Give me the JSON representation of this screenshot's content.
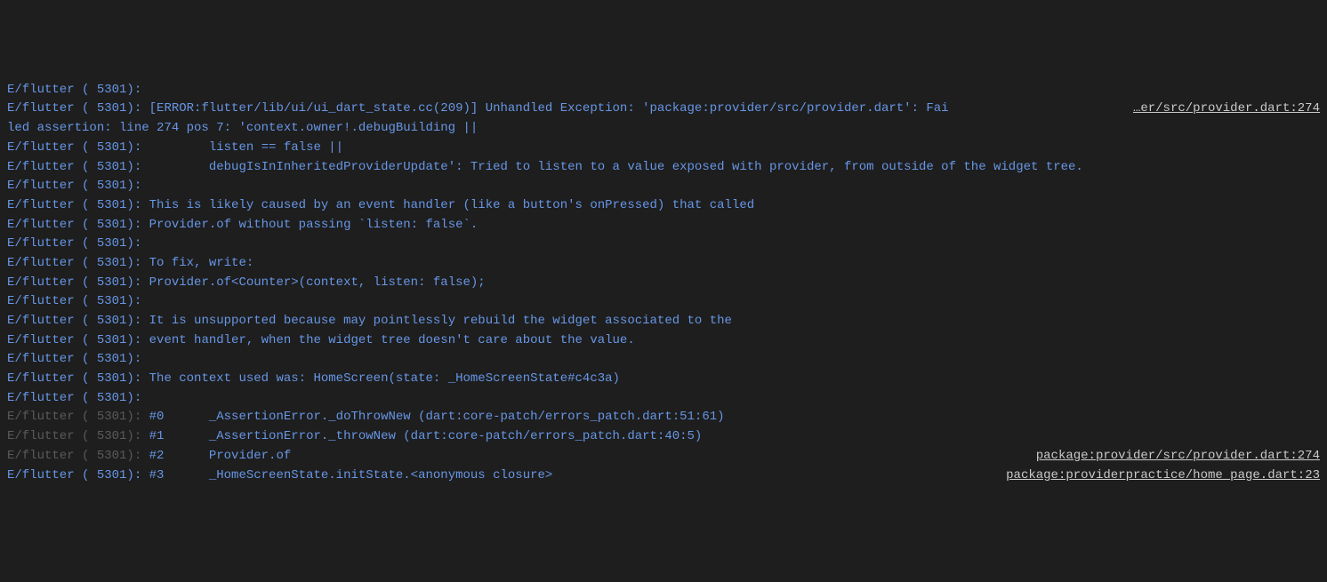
{
  "prefix": "E/flutter ( 5301):",
  "links": {
    "provider274_trunc": "…er/src/provider.dart:274",
    "provider274": "package:provider/src/provider.dart:274",
    "homepage23": "package:providerpractice/home_page.dart:23"
  },
  "lines": [
    {
      "text": " ",
      "dim": false
    },
    {
      "text": " [ERROR:flutter/lib/ui/ui_dart_state.cc(209)] Unhandled Exception: 'package:provider/src/provider.dart': Fai",
      "dim": false,
      "link": "provider274_trunc",
      "noPrefixContinuation": false
    },
    {
      "text": "led assertion: line 274 pos 7: 'context.owner!.debugBuilding ||",
      "dim": false,
      "raw": true
    },
    {
      "text": "         listen == false ||",
      "dim": false
    },
    {
      "text": "         debugIsInInheritedProviderUpdate': Tried to listen to a value exposed with provider, from outside of the widget tree.",
      "dim": false
    },
    {
      "text": " ",
      "dim": false
    },
    {
      "text": " This is likely caused by an event handler (like a button's onPressed) that called",
      "dim": false
    },
    {
      "text": " Provider.of without passing `listen: false`.",
      "dim": false
    },
    {
      "text": " ",
      "dim": false
    },
    {
      "text": " To fix, write:",
      "dim": false
    },
    {
      "text": " Provider.of<Counter>(context, listen: false);",
      "dim": false
    },
    {
      "text": " ",
      "dim": false
    },
    {
      "text": " It is unsupported because may pointlessly rebuild the widget associated to the",
      "dim": false
    },
    {
      "text": " event handler, when the widget tree doesn't care about the value.",
      "dim": false
    },
    {
      "text": " ",
      "dim": false
    },
    {
      "text": " The context used was: HomeScreen(state: _HomeScreenState#c4c3a)",
      "dim": false
    },
    {
      "text": " ",
      "dim": false
    },
    {
      "text": " #0      _AssertionError._doThrowNew (dart:core-patch/errors_patch.dart:51:61)",
      "dim": true
    },
    {
      "text": " #1      _AssertionError._throwNew (dart:core-patch/errors_patch.dart:40:5)",
      "dim": true
    },
    {
      "text": " #2      Provider.of",
      "dim": true,
      "link": "provider274"
    },
    {
      "text": " #3      _HomeScreenState.initState.<anonymous closure>",
      "dim": false,
      "link": "homepage23"
    }
  ]
}
